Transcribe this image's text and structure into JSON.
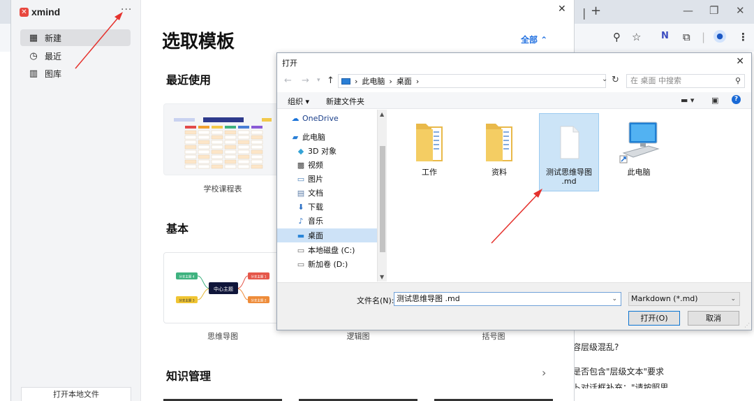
{
  "browser": {
    "close": "✕",
    "restore": "❐",
    "minimize": "—",
    "newtab": "+",
    "bg_lines": [
      "容层级混乱?",
      "是否包含\"层级文本\"要求",
      "卜对话框补充：\"请按照思"
    ]
  },
  "xmind": {
    "app_name": "xmind",
    "more": "···",
    "nav": [
      {
        "icon": "grid-icon",
        "label": "新建"
      },
      {
        "icon": "clock-icon",
        "label": "最近"
      },
      {
        "icon": "library-icon",
        "label": "图库"
      }
    ],
    "open_local": "打开本地文件",
    "title": "选取模板",
    "filter": "全部 ⌃",
    "sections": {
      "recent": "最近使用",
      "basic": "基本",
      "knowledge": "知识管理"
    },
    "templates": {
      "school": "学校课程表",
      "mindmap": "思维导图",
      "logic": "逻辑图",
      "brace": "括号图"
    },
    "mindmap_preview": {
      "center": "中心主题",
      "branches": [
        "分支主题 4",
        "分支主题 1",
        "分支主题 3",
        "分支主题 2"
      ]
    }
  },
  "dialog": {
    "title": "打开",
    "breadcrumb": [
      "此电脑",
      "桌面"
    ],
    "search_placeholder": "在 桌面 中搜索",
    "organize": "组织 ▾",
    "new_folder": "新建文件夹",
    "tree": [
      {
        "icon": "cloud-icon",
        "label": "OneDrive",
        "color": "#1a73d9"
      },
      {
        "icon": "pc-icon",
        "label": "此电脑"
      },
      {
        "icon": "cube-icon",
        "label": "3D 对象"
      },
      {
        "icon": "video-icon",
        "label": "视频"
      },
      {
        "icon": "picture-icon",
        "label": "图片"
      },
      {
        "icon": "doc-icon",
        "label": "文档"
      },
      {
        "icon": "download-icon",
        "label": "下载"
      },
      {
        "icon": "music-icon",
        "label": "音乐"
      },
      {
        "icon": "desktop-icon",
        "label": "桌面"
      },
      {
        "icon": "disk-icon",
        "label": "本地磁盘 (C:)"
      },
      {
        "icon": "disk-icon",
        "label": "新加卷 (D:)"
      }
    ],
    "files": [
      {
        "name": "工作"
      },
      {
        "name": "资料"
      },
      {
        "name": "测试思维导图",
        "name2": ".md"
      },
      {
        "name": "此电脑"
      }
    ],
    "filename_label": "文件名(N):",
    "filename_value": "测试思维导图 .md",
    "filetype": "Markdown (*.md)",
    "open_btn": "打开(O)",
    "cancel_btn": "取消"
  },
  "colors": {
    "accent": "#1f6fe0",
    "arrow": "#e5322d",
    "selection": "#cce4f7"
  }
}
